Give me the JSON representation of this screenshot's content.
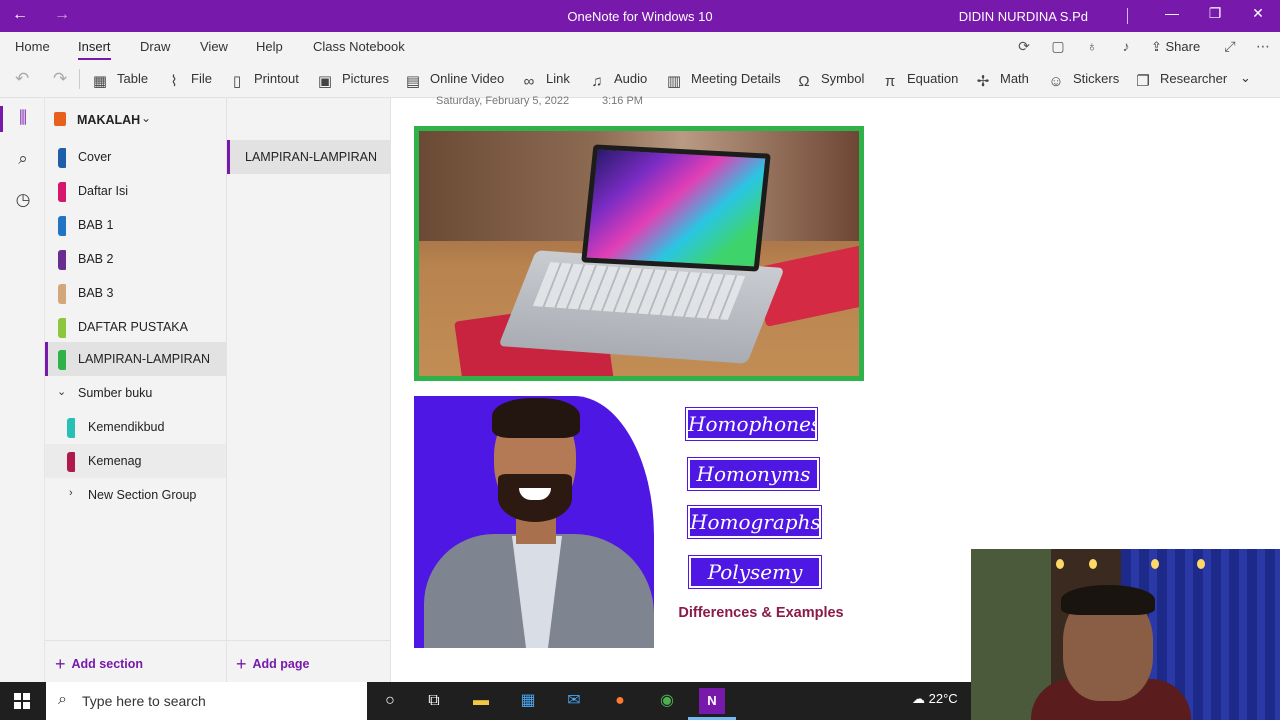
{
  "titlebar": {
    "title": "OneNote for Windows 10",
    "user": "DIDIN NURDINA S.Pd",
    "back_icon": "←",
    "forward_icon": "→",
    "min_icon": "—",
    "max_icon": "❐",
    "close_icon": "✕"
  },
  "ribbon_tabs": [
    "Home",
    "Insert",
    "Draw",
    "View",
    "Help",
    "Class Notebook"
  ],
  "ribbon_right": {
    "share_label": "Share"
  },
  "toolbar": {
    "table": "Table",
    "file": "File",
    "printout": "Printout",
    "pictures": "Pictures",
    "online_video": "Online Video",
    "link": "Link",
    "audio": "Audio",
    "meeting_details": "Meeting Details",
    "symbol": "Symbol",
    "equation": "Equation",
    "math": "Math",
    "stickers": "Stickers",
    "researcher": "Researcher"
  },
  "notebook": {
    "name": "MAKALAH",
    "icon_color": "#e8601d"
  },
  "sections": [
    {
      "label": "Cover",
      "color": "#1f5fa8"
    },
    {
      "label": "Daftar Isi",
      "color": "#d6166c"
    },
    {
      "label": "BAB 1",
      "color": "#1f74c4"
    },
    {
      "label": "BAB 2",
      "color": "#6a2c91"
    },
    {
      "label": "BAB 3",
      "color": "#d3a77b"
    },
    {
      "label": "DAFTAR PUSTAKA",
      "color": "#8cc63f"
    },
    {
      "label": "LAMPIRAN-LAMPIRAN",
      "color": "#2fb24a"
    }
  ],
  "section_group": {
    "label": "Sumber buku",
    "children": [
      {
        "label": "Kemendikbud",
        "color": "#27c0b5"
      },
      {
        "label": "Kemenag",
        "color": "#b01a4a"
      }
    ]
  },
  "new_section_group": "New Section Group",
  "add_section": "Add section",
  "pages": [
    "LAMPIRAN-LAMPIRAN"
  ],
  "add_page": "Add page",
  "page_meta": {
    "date": "Saturday, February 5, 2022",
    "time": "3:16 PM"
  },
  "homo_image": {
    "words": [
      "Homophones",
      "Homonyms",
      "Homographs",
      "Polysemy"
    ],
    "caption": "Differences & Examples"
  },
  "taskbar": {
    "search_placeholder": "Type here to search",
    "temperature": "22°C"
  },
  "colors": {
    "accent": "#7719aa",
    "picture_border": "#2fb24a",
    "word_box": "#4f17e3"
  }
}
